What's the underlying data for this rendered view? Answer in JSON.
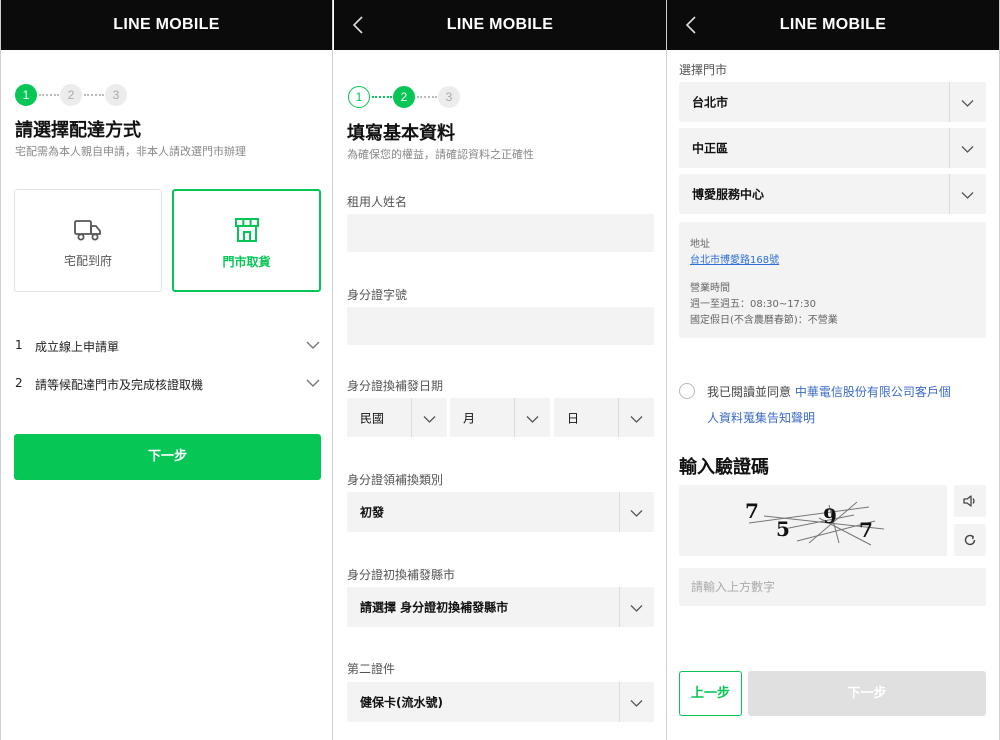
{
  "brand": "LINE MOBILE",
  "colors": {
    "accent": "#06c755",
    "header_bg": "#0b0b0b",
    "link": "#2d6fd6"
  },
  "panel1": {
    "steps": [
      "1",
      "2",
      "3"
    ],
    "title": "請選擇配達方式",
    "subtitle": "宅配需為本人親自申請，非本人請改選門市辦理",
    "options": [
      {
        "label": "宅配到府",
        "icon": "truck-icon",
        "selected": false
      },
      {
        "label": "門市取貨",
        "icon": "store-icon",
        "selected": true
      }
    ],
    "accordion": [
      {
        "num": "1",
        "label": "成立線上申請單"
      },
      {
        "num": "2",
        "label": "請等候配達門市及完成核證取機"
      }
    ],
    "next_label": "下一步"
  },
  "panel2": {
    "steps": [
      "1",
      "2",
      "3"
    ],
    "title": "填寫基本資料",
    "subtitle": "為確保您的權益，請確認資料之正確性",
    "name_label": "租用人姓名",
    "id_label": "身分證字號",
    "issue_date_label": "身分證換補發日期",
    "date_selects": {
      "era": "民國",
      "month": "月",
      "day": "日"
    },
    "issue_type_label": "身分證領補換類別",
    "issue_type_value": "初發",
    "issue_city_label": "身分證初換補發縣市",
    "issue_city_value": "請選擇 身分證初換補發縣市",
    "second_doc_label": "第二證件",
    "second_doc_value": "健保卡(流水號)"
  },
  "panel3": {
    "store_label": "選擇門市",
    "city": "台北市",
    "district": "中正區",
    "store": "博愛服務中心",
    "address_label": "地址",
    "address": "台北市博愛路168號",
    "hours_label": "營業時間",
    "hours_weekday": "週一至週五：08:30~17:30",
    "hours_holiday": "國定假日(不含農曆春節)：不營業",
    "agree_prefix": "我已閱讀並同意",
    "agree_link_1": "中華電信股份有限公司客戶個",
    "agree_link_2": "人資料蒐集告知聲明",
    "captcha_title": "輸入驗證碼",
    "captcha_digits": [
      "7",
      "5",
      "9",
      "7"
    ],
    "captcha_placeholder": "請輸入上方數字",
    "prev_label": "上一步",
    "next_label": "下一步"
  }
}
